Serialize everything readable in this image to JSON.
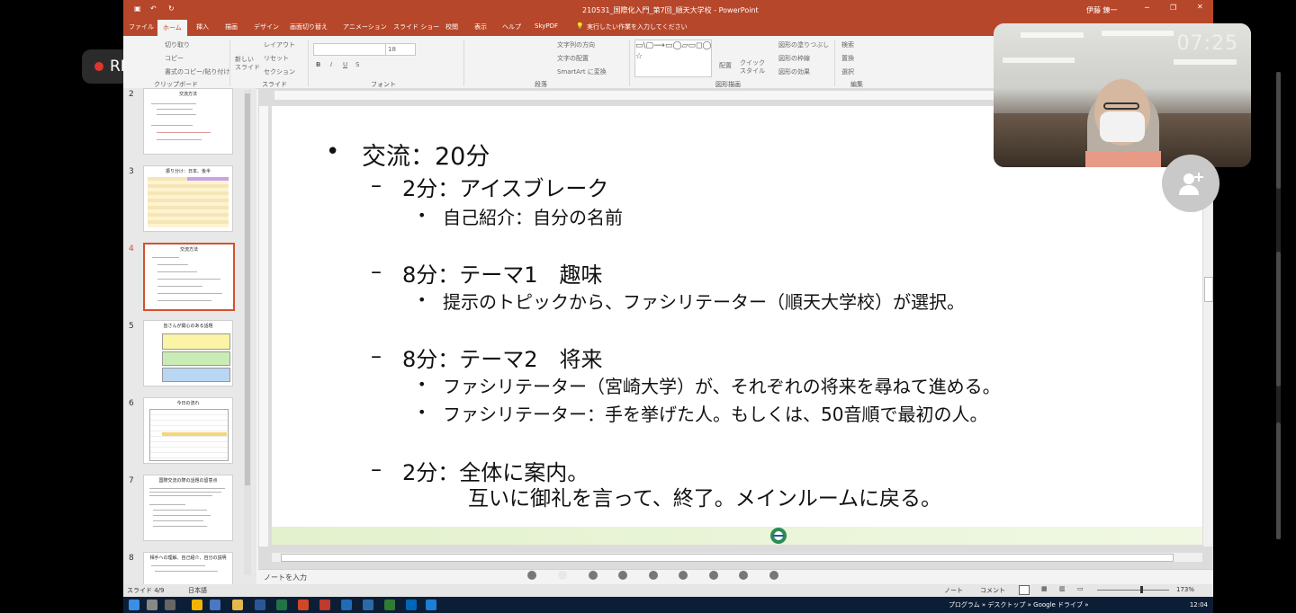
{
  "window": {
    "title": "210531_国際化入門_第7回_順天大学校 - PowerPoint",
    "user": "伊藤 錬一",
    "search_placeholder": "実行したい作業を入力してください"
  },
  "ribbon_tabs": [
    "ファイル",
    "ホーム",
    "挿入",
    "描画",
    "デザイン",
    "画面切り替え",
    "アニメーション",
    "スライド ショー",
    "校閲",
    "表示",
    "ヘルプ",
    "SkyPDF"
  ],
  "ribbon": {
    "clipboard": {
      "cut": "切り取り",
      "copy": "コピー",
      "format": "書式のコピー/貼り付け",
      "group": "クリップボード"
    },
    "slides": {
      "new": "新しい スライド",
      "layout": "レイアウト",
      "reset": "リセット",
      "section": "セクション",
      "group": "スライド"
    },
    "font": {
      "size": "18",
      "group": "フォント"
    },
    "paragraph": {
      "direction": "文字列の方向",
      "align": "文字の配置",
      "smartart": "SmartArt に変換",
      "group": "段落"
    },
    "drawing": {
      "arrange": "配置",
      "quickstyle": "クイック スタイル",
      "fill": "図形の塗りつぶし",
      "outline": "図形の枠線",
      "effects": "図形の効果",
      "group": "図形描画"
    },
    "editing": {
      "find": "検索",
      "replace": "置換",
      "select": "選択",
      "group": "編集"
    }
  },
  "thumbnails": [
    {
      "num": "2",
      "title": "交流方法"
    },
    {
      "num": "3",
      "title": "振り分け：日本、後半"
    },
    {
      "num": "4",
      "title": "交流方法"
    },
    {
      "num": "5",
      "title": "皆さんが関心のある話題"
    },
    {
      "num": "6",
      "title": "今日の流れ"
    },
    {
      "num": "7",
      "title": "国際交流の際の話題の留意点"
    },
    {
      "num": "8",
      "title": "相手への理解、自己紹介、自分の説明"
    }
  ],
  "slide": {
    "lines": [
      {
        "level": 1,
        "text": "交流：20分"
      },
      {
        "level": 2,
        "text": "2分：アイスブレーク"
      },
      {
        "level": 3,
        "text": "自己紹介：自分の名前"
      },
      {
        "level": 2,
        "text": "8分：テーマ1　趣味"
      },
      {
        "level": 3,
        "text": "提示のトピックから、ファシリテーター（順天大学校）が選択。"
      },
      {
        "level": 2,
        "text": "8分：テーマ2　将来"
      },
      {
        "level": 3,
        "text": "ファシリテーター（宮崎大学）が、それぞれの将来を尋ねて進める。"
      },
      {
        "level": 3,
        "text": "ファシリテーター：手を挙げた人。もしくは、50音順で最初の人。"
      },
      {
        "level": 2,
        "text": "2分：全体に案内。"
      },
      {
        "level": 0,
        "text": "互いに御礼を言って、終了。メインルームに戻る。"
      }
    ]
  },
  "notes_placeholder": "ノートを入力",
  "status": {
    "slide": "スライド 4/9",
    "lang": "日本語",
    "notes": "ノート",
    "comments": "コメント",
    "zoom": "173%"
  },
  "taskbar": {
    "tray": "プログラム » デスクトップ » Google ドライブ »",
    "time": "12:04"
  },
  "rec_label": "REC",
  "camera_time": "07:25",
  "colors": {
    "accent": "#b7472a",
    "rec_dot": "#e0352a"
  }
}
